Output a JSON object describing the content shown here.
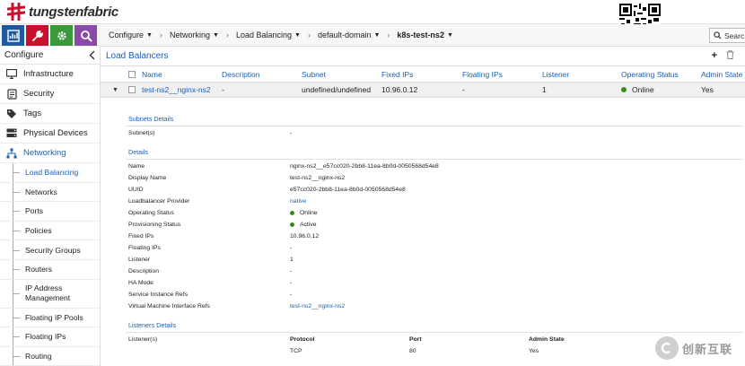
{
  "brand": {
    "name": "tungstenfabric",
    "accent": "#c8102e"
  },
  "topnav": {
    "icons": [
      "monitor-icon",
      "wrench-icon",
      "gear-icon",
      "search-icon"
    ],
    "colors": [
      "#1f5a9e",
      "#c8102e",
      "#3a9a3a",
      "#8a4aa8"
    ]
  },
  "sidebar": {
    "title": "Configure",
    "items": [
      {
        "label": "Infrastructure",
        "icon": "monitor-icon"
      },
      {
        "label": "Security",
        "icon": "security-icon"
      },
      {
        "label": "Tags",
        "icon": "tag-icon"
      },
      {
        "label": "Physical Devices",
        "icon": "server-icon"
      },
      {
        "label": "Networking",
        "icon": "network-icon"
      }
    ],
    "subitems": [
      "Load Balancing",
      "Networks",
      "Ports",
      "Policies",
      "Security Groups",
      "Routers",
      "IP Address Management",
      "Floating IP Pools",
      "Floating IPs",
      "Routing"
    ]
  },
  "breadcrumb": {
    "items": [
      "Configure",
      "Networking",
      "Load Balancing",
      "default-domain",
      "k8s-test-ns2"
    ],
    "search_placeholder": "Searc"
  },
  "panel": {
    "title": "Load Balancers",
    "columns": [
      "Name",
      "Description",
      "Subnet",
      "Fixed IPs",
      "Floating IPs",
      "Listener",
      "Operating Status",
      "Admin State"
    ],
    "row": {
      "name": "test-ns2__nginx-ns2",
      "description": "-",
      "subnet": "undefined/undefined",
      "fixed_ips": "10.96.0.12",
      "floating_ips": "-",
      "listener": "1",
      "operating_status": "Online",
      "admin_state": "Yes"
    }
  },
  "details": {
    "subnets_title": "Subnets Details",
    "subnets_label": "Subnet(s)",
    "subnets_value": "-",
    "details_title": "Details",
    "fields": [
      {
        "k": "Name",
        "v": "nginx-ns2__e57cc020-2bb8-11ea-8b0d-0050568d54e8"
      },
      {
        "k": "Display Name",
        "v": "test-ns2__nginx-ns2"
      },
      {
        "k": "UUID",
        "v": "e57cc020-2bb8-11ea-8b0d-0050568d54e8"
      },
      {
        "k": "Loadbalancer Provider",
        "v": "native"
      },
      {
        "k": "Operating Status",
        "v": "Online"
      },
      {
        "k": "Provisioning Status",
        "v": "Active"
      },
      {
        "k": "Fixed IPs",
        "v": "10.96.0.12"
      },
      {
        "k": "Floating IPs",
        "v": "-"
      },
      {
        "k": "Listener",
        "v": "1"
      },
      {
        "k": "Description",
        "v": "-"
      },
      {
        "k": "HA Mode",
        "v": "-"
      },
      {
        "k": "Service Instance Refs",
        "v": "-"
      },
      {
        "k": "Virtual Machine Interface Refs",
        "v": "test-ns2__nginx-ns2"
      }
    ],
    "listeners_title": "Listeners Details",
    "listeners_label": "Listener(s)",
    "listener_columns": [
      "Protocol",
      "Port",
      "Admin State"
    ],
    "listener_row": [
      "TCP",
      "80",
      "Yes"
    ]
  },
  "watermark": {
    "text": "创新互联"
  }
}
